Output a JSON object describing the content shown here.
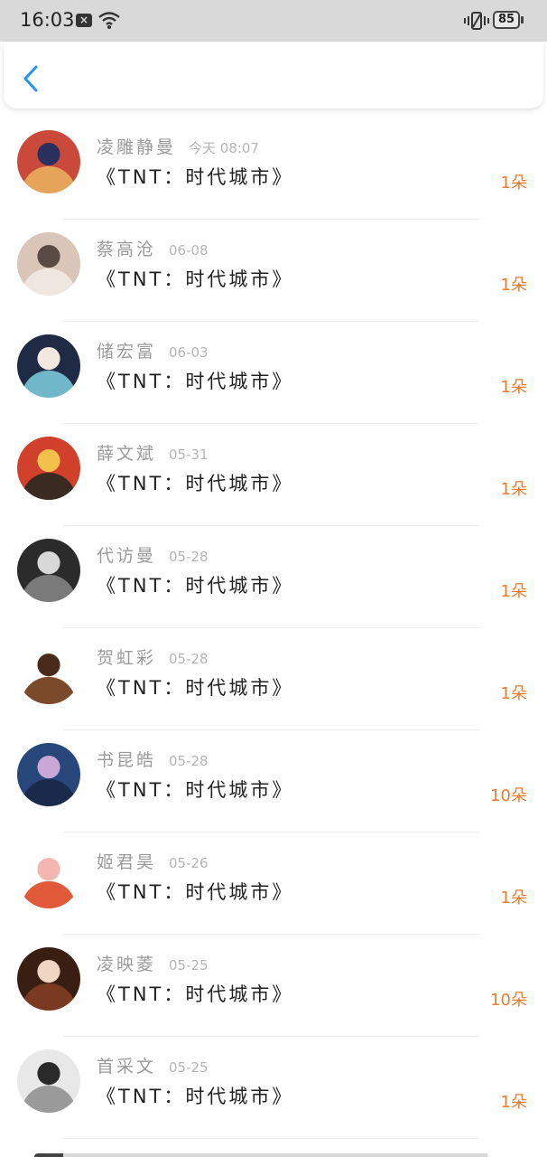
{
  "status_bar": {
    "time": "16:03",
    "sim_icon": "x-box-icon",
    "battery": "85"
  },
  "appbar": {
    "back_icon": "chevron-left-icon",
    "accent": "#2196f3"
  },
  "items": [
    {
      "name": "凌雕静曼",
      "date": "今天 08:07",
      "title": "《TNT：时代城市》",
      "count": "1朵",
      "avatar_colors": [
        "#c94a3a",
        "#2b2f5e",
        "#e6a35a"
      ]
    },
    {
      "name": "蔡高沧",
      "date": "06-08",
      "title": "《TNT：时代城市》",
      "count": "1朵",
      "avatar_colors": [
        "#d9c6b8",
        "#5a4a44",
        "#f0e6e0"
      ]
    },
    {
      "name": "储宏富",
      "date": "06-03",
      "title": "《TNT：时代城市》",
      "count": "1朵",
      "avatar_colors": [
        "#1f2a44",
        "#f2e8df",
        "#6fb7c9"
      ]
    },
    {
      "name": "薛文斌",
      "date": "05-31",
      "title": "《TNT：时代城市》",
      "count": "1朵",
      "avatar_colors": [
        "#d1402a",
        "#f2c04b",
        "#3a2a20"
      ]
    },
    {
      "name": "代访曼",
      "date": "05-28",
      "title": "《TNT：时代城市》",
      "count": "1朵",
      "avatar_colors": [
        "#2b2b2b",
        "#d8d8d8",
        "#7a7a7a"
      ]
    },
    {
      "name": "贺虹彩",
      "date": "05-28",
      "title": "《TNT：时代城市》",
      "count": "1朵",
      "avatar_colors": [
        "#ffffff",
        "#4a2a1a",
        "#7a4a2a"
      ]
    },
    {
      "name": "书昆皓",
      "date": "05-28",
      "title": "《TNT：时代城市》",
      "count": "10朵",
      "avatar_colors": [
        "#27467a",
        "#c9a7d6",
        "#1a2a4a"
      ]
    },
    {
      "name": "姬君昊",
      "date": "05-26",
      "title": "《TNT：时代城市》",
      "count": "1朵",
      "avatar_colors": [
        "#ffffff",
        "#f4b6b0",
        "#e05a3a"
      ]
    },
    {
      "name": "凌映菱",
      "date": "05-25",
      "title": "《TNT：时代城市》",
      "count": "10朵",
      "avatar_colors": [
        "#3a1e12",
        "#f0d6c2",
        "#7a3a22"
      ]
    },
    {
      "name": "首采文",
      "date": "05-25",
      "title": "《TNT：时代城市》",
      "count": "1朵",
      "avatar_colors": [
        "#e8e8e8",
        "#2a2a2a",
        "#9a9a9a"
      ]
    }
  ]
}
